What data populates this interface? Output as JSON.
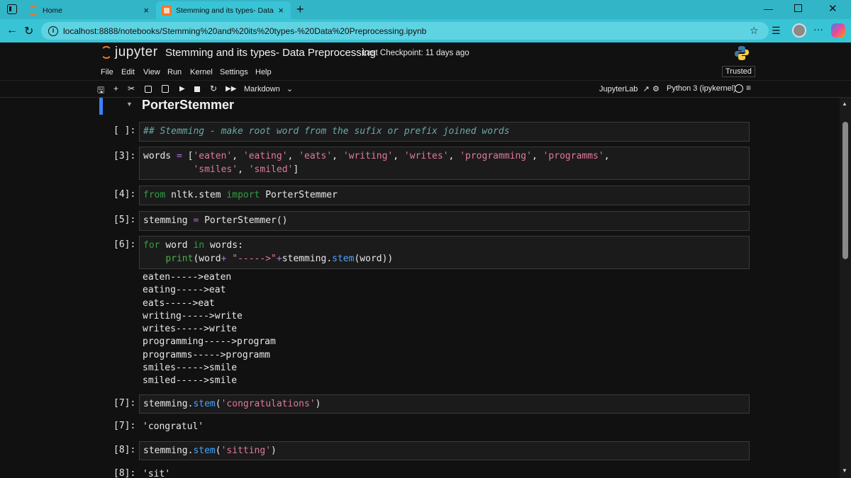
{
  "browser": {
    "tabs": [
      {
        "label": "Home"
      },
      {
        "label": "Stemming and its types- Data Pre"
      }
    ],
    "tab_close_glyph": "×",
    "new_tab_glyph": "+",
    "url": "localhost:8888/notebooks/Stemming%20and%20its%20types-%20Data%20Preprocessing.ipynb",
    "more_glyph": "···"
  },
  "jupyter": {
    "logo_text": "jupyter",
    "notebook_title": "Stemming and its types- Data Preprocessing",
    "checkpoint": "Last Checkpoint: 11 days ago",
    "menu": [
      "File",
      "Edit",
      "View",
      "Run",
      "Kernel",
      "Settings",
      "Help"
    ],
    "trusted": "Trusted",
    "cell_type": "Markdown",
    "jupyterlab_link": "JupyterLab",
    "kernel": "Python 3 (ipykernel)"
  },
  "notebook": {
    "heading": "PorterStemmer",
    "prompts": {
      "c1": "[ ]:",
      "c3": "[3]:",
      "c4": "[4]:",
      "c5": "[5]:",
      "c6": "[6]:",
      "c7": "[7]:",
      "o7": "[7]:",
      "c8": "[8]:",
      "o8": "[8]:"
    },
    "code": {
      "c1": "## Stemming - make root word from the sufix or prefix joined words",
      "c3_var": "words",
      "c3_eq": " = ",
      "c3_open": "[",
      "c3_items": [
        "'eaten'",
        "'eating'",
        "'eats'",
        "'writing'",
        "'writes'",
        "'programming'",
        "'programms'",
        "'smiles'",
        "'smiled'"
      ],
      "c3_close": "]",
      "c4_from": "from",
      "c4_module": "nltk.stem",
      "c4_import": "import",
      "c4_name": "PorterStemmer",
      "c5_var": "stemming",
      "c5_eq": "=",
      "c5_call": "PorterStemmer()",
      "c6_for": "for",
      "c6_var": "word",
      "c6_in": "in",
      "c6_iter": "words:",
      "c6_print": "print",
      "c6_arg1": "(word",
      "c6_plus1": "+",
      "c6_str": "\"----->\"",
      "c6_plus2": "+",
      "c6_obj": "stemming.",
      "c6_method": "stem",
      "c6_tail": "(word))",
      "c7_obj": "stemming.",
      "c7_method": "stem",
      "c7_arg": "'congratulations'",
      "c8_obj": "stemming.",
      "c8_method": "stem",
      "c8_arg": "'sitting'"
    },
    "outputs": {
      "o6": [
        "eaten----->eaten",
        "eating----->eat",
        "eats----->eat",
        "writing----->write",
        "writes----->write",
        "programming----->program",
        "programms----->programm",
        "smiles----->smile",
        "smiled----->smile"
      ],
      "o7": "'congratul'",
      "o8": "'sit'"
    }
  }
}
